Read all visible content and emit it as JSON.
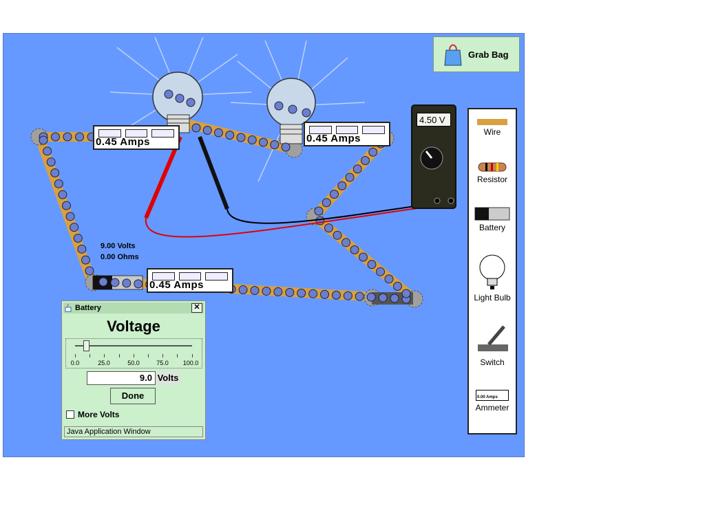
{
  "colors": {
    "canvas_bg": "#6699ff",
    "wire": "#d9a040",
    "electron": "#6a7fcf",
    "panel_green": "#ccefcc"
  },
  "grab_bag": {
    "label": "Grab Bag",
    "icon": "shopping-bag-icon"
  },
  "toolbox": {
    "items": [
      {
        "label": "Wire",
        "icon": "wire-icon"
      },
      {
        "label": "Resistor",
        "icon": "resistor-icon"
      },
      {
        "label": "Battery",
        "icon": "battery-icon"
      },
      {
        "label": "Light Bulb",
        "icon": "light-bulb-icon"
      },
      {
        "label": "Switch",
        "icon": "switch-icon"
      },
      {
        "label": "Ammeter",
        "icon": "ammeter-icon",
        "mini_reading": "0.00 Amps"
      }
    ]
  },
  "ammeters": [
    {
      "reading": "0.45 Amps"
    },
    {
      "reading": "0.45 Amps"
    },
    {
      "reading": "0.45 Amps"
    }
  ],
  "voltmeter": {
    "display": "4.50 V"
  },
  "battery_info": {
    "voltage": "9.00 Volts",
    "resistance": "0.00 Ohms"
  },
  "dialog": {
    "title": "Battery",
    "heading": "Voltage",
    "slider_value": 9.0,
    "slider_min": 0,
    "slider_max": 100,
    "tick_labels": [
      "0.0",
      "25.0",
      "50.0",
      "75.0",
      "100.0"
    ],
    "value": "9.0",
    "unit": "Volts",
    "done_label": "Done",
    "more_volts_label": "More Volts",
    "more_volts_checked": false,
    "status": "Java Application Window",
    "close_label": "✕"
  }
}
